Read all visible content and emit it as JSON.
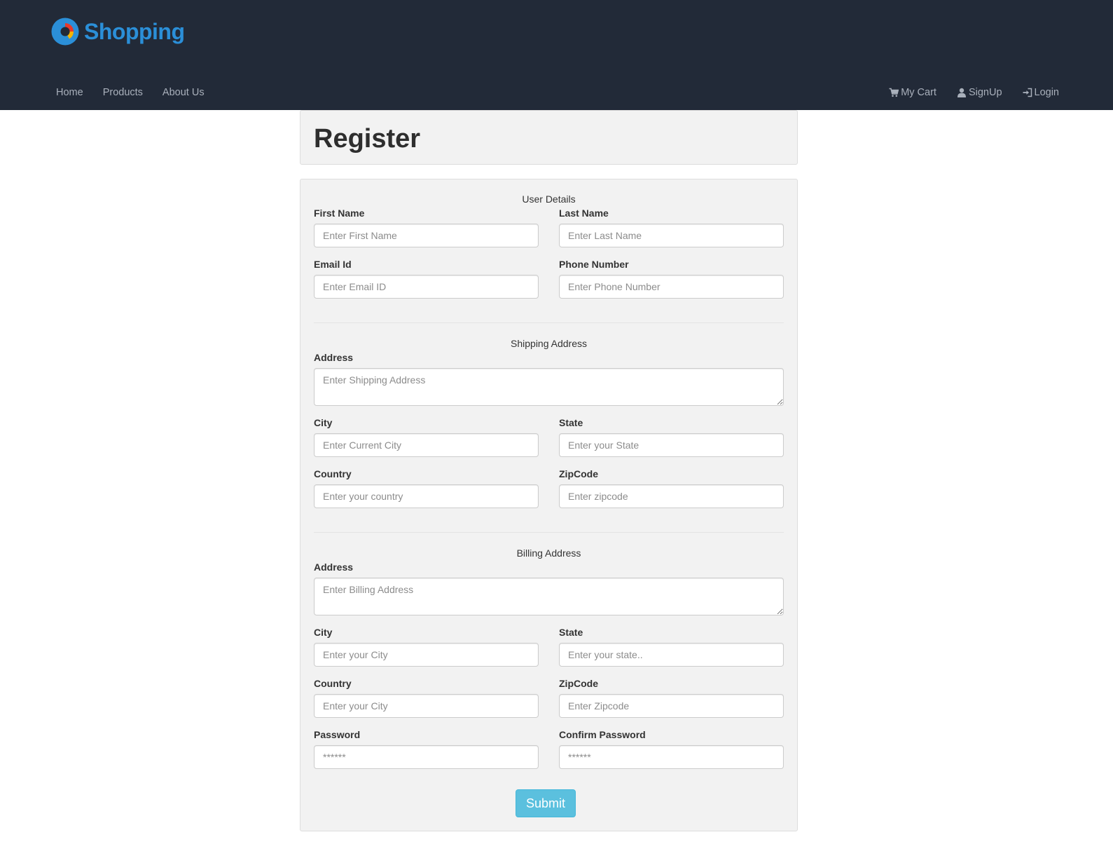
{
  "brand": {
    "name": "Shopping",
    "logo_icon": "shopping-logo-icon"
  },
  "nav": {
    "left": [
      "Home",
      "Products",
      "About Us"
    ],
    "right": [
      {
        "label": "My Cart",
        "icon": "cart-icon"
      },
      {
        "label": "SignUp",
        "icon": "user-icon"
      },
      {
        "label": "Login",
        "icon": "login-icon"
      }
    ]
  },
  "page": {
    "title": "Register"
  },
  "form": {
    "user_details": {
      "legend": "User Details",
      "first_name": {
        "label": "First Name",
        "placeholder": "Enter First Name"
      },
      "last_name": {
        "label": "Last Name",
        "placeholder": "Enter Last Name"
      },
      "email": {
        "label": "Email Id",
        "placeholder": "Enter Email ID"
      },
      "phone": {
        "label": "Phone Number",
        "placeholder": "Enter Phone Number"
      }
    },
    "shipping": {
      "legend": "Shipping Address",
      "address": {
        "label": "Address",
        "placeholder": "Enter Shipping Address"
      },
      "city": {
        "label": "City",
        "placeholder": "Enter Current City"
      },
      "state": {
        "label": "State",
        "placeholder": "Enter your State"
      },
      "country": {
        "label": "Country",
        "placeholder": "Enter your country"
      },
      "zipcode": {
        "label": "ZipCode",
        "placeholder": "Enter zipcode"
      }
    },
    "billing": {
      "legend": "Billing Address",
      "address": {
        "label": "Address",
        "placeholder": "Enter Billing Address"
      },
      "city": {
        "label": "City",
        "placeholder": "Enter your City"
      },
      "state": {
        "label": "State",
        "placeholder": "Enter your state.."
      },
      "country": {
        "label": "Country",
        "placeholder": "Enter your City"
      },
      "zipcode": {
        "label": "ZipCode",
        "placeholder": "Enter Zipcode"
      }
    },
    "password": {
      "label": "Password",
      "placeholder": "******"
    },
    "confirm_password": {
      "label": "Confirm Password",
      "placeholder": "******"
    },
    "submit_label": "Submit"
  },
  "colors": {
    "navbar": "#222a38",
    "brand": "#2b8fd8",
    "nav_text": "#a9b0bb",
    "panel": "#f2f2f2",
    "submit": "#5bc0de"
  }
}
